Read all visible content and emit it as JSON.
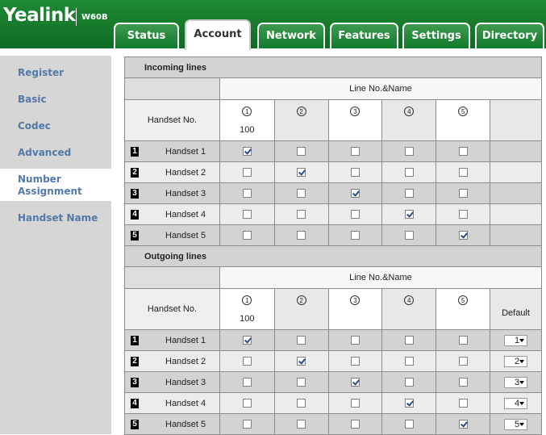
{
  "brand": {
    "name": "Yealink",
    "model": "W60B"
  },
  "tabs": [
    {
      "label": "Status",
      "active": false
    },
    {
      "label": "Account",
      "active": true
    },
    {
      "label": "Network",
      "active": false
    },
    {
      "label": "Features",
      "active": false
    },
    {
      "label": "Settings",
      "active": false
    },
    {
      "label": "Directory",
      "active": false
    }
  ],
  "sidebar": {
    "items": [
      {
        "label": "Register",
        "active": false
      },
      {
        "label": "Basic",
        "active": false
      },
      {
        "label": "Codec",
        "active": false
      },
      {
        "label": "Advanced",
        "active": false
      },
      {
        "label": "Number Assignment",
        "active": true
      },
      {
        "label": "Handset Name",
        "active": false
      }
    ]
  },
  "incoming": {
    "title": "Incoming lines",
    "line_header": "Line No.&Name",
    "handset_header": "Handset No.",
    "lines": [
      {
        "symbol": "1",
        "name": "100"
      },
      {
        "symbol": "2",
        "name": ""
      },
      {
        "symbol": "3",
        "name": ""
      },
      {
        "symbol": "4",
        "name": ""
      },
      {
        "symbol": "5",
        "name": ""
      }
    ],
    "rows": [
      {
        "num": "1",
        "name": "Handset 1",
        "checks": [
          true,
          false,
          false,
          false,
          false
        ]
      },
      {
        "num": "2",
        "name": "Handset 2",
        "checks": [
          false,
          true,
          false,
          false,
          false
        ]
      },
      {
        "num": "3",
        "name": "Handset 3",
        "checks": [
          false,
          false,
          true,
          false,
          false
        ]
      },
      {
        "num": "4",
        "name": "Handset 4",
        "checks": [
          false,
          false,
          false,
          true,
          false
        ]
      },
      {
        "num": "5",
        "name": "Handset 5",
        "checks": [
          false,
          false,
          false,
          false,
          true
        ]
      }
    ]
  },
  "outgoing": {
    "title": "Outgoing lines",
    "line_header": "Line No.&Name",
    "handset_header": "Handset No.",
    "default_header": "Default",
    "lines": [
      {
        "symbol": "1",
        "name": "100"
      },
      {
        "symbol": "2",
        "name": ""
      },
      {
        "symbol": "3",
        "name": ""
      },
      {
        "symbol": "4",
        "name": ""
      },
      {
        "symbol": "5",
        "name": ""
      }
    ],
    "rows": [
      {
        "num": "1",
        "name": "Handset 1",
        "checks": [
          true,
          false,
          false,
          false,
          false
        ],
        "default": "1"
      },
      {
        "num": "2",
        "name": "Handset 2",
        "checks": [
          false,
          true,
          false,
          false,
          false
        ],
        "default": "2"
      },
      {
        "num": "3",
        "name": "Handset 3",
        "checks": [
          false,
          false,
          true,
          false,
          false
        ],
        "default": "3"
      },
      {
        "num": "4",
        "name": "Handset 4",
        "checks": [
          false,
          false,
          false,
          true,
          false
        ],
        "default": "4"
      },
      {
        "num": "5",
        "name": "Handset 5",
        "checks": [
          false,
          false,
          false,
          false,
          true
        ],
        "default": "5"
      }
    ]
  }
}
